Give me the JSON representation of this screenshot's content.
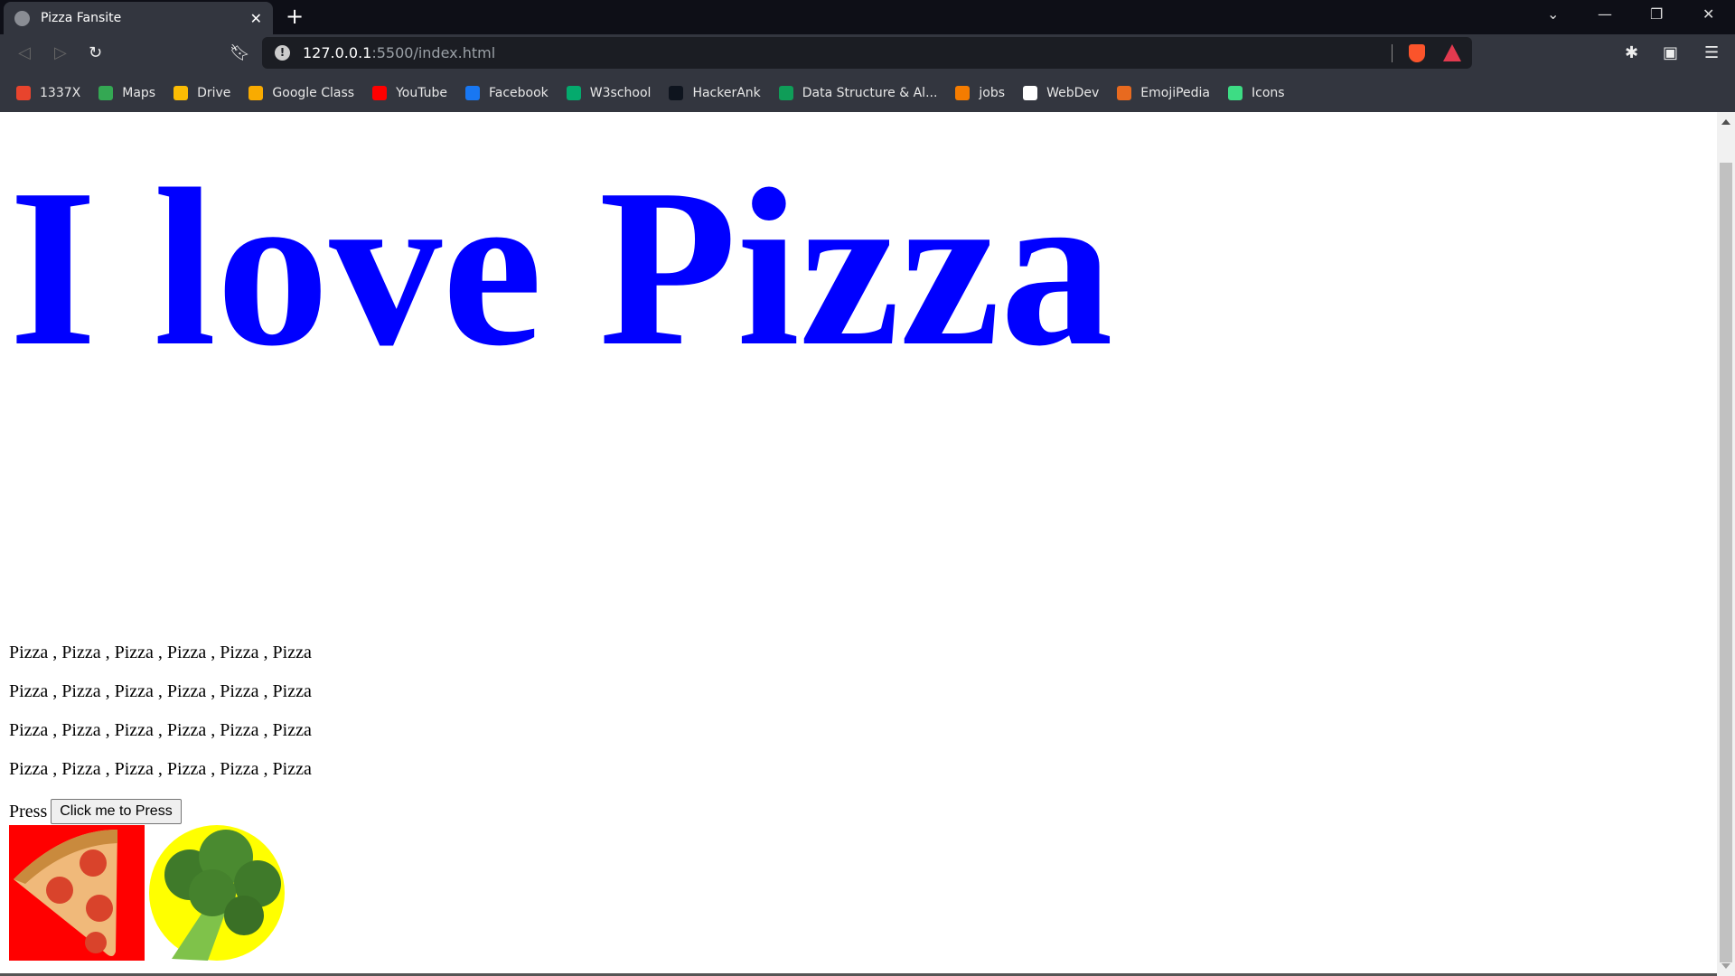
{
  "browser": {
    "tab_title": "Pizza Fansite",
    "url_host": "127.0.0.1",
    "url_rest": ":5500/index.html",
    "bookmarks": [
      {
        "label": "1337X",
        "color": "#e8442d"
      },
      {
        "label": "Maps",
        "color": "#34a853"
      },
      {
        "label": "Drive",
        "color": "#fbbc04"
      },
      {
        "label": "Google Class",
        "color": "#f9ab00"
      },
      {
        "label": "YouTube",
        "color": "#ff0000"
      },
      {
        "label": "Facebook",
        "color": "#1877f2"
      },
      {
        "label": "W3school",
        "color": "#04aa6d"
      },
      {
        "label": "HackerAnk",
        "color": "#0e141e"
      },
      {
        "label": "Data Structure & Al...",
        "color": "#0f9d58"
      },
      {
        "label": "jobs",
        "color": "#f57c00"
      },
      {
        "label": "WebDev",
        "color": "#ffffff"
      },
      {
        "label": "EmojiPedia",
        "color": "#e86a1f"
      },
      {
        "label": "Icons",
        "color": "#3ddc84"
      }
    ]
  },
  "page": {
    "heading": "I love Pizza",
    "heading_color": "#0000ff",
    "paragraphs": [
      "Pizza , Pizza , Pizza , Pizza , Pizza , Pizza",
      "Pizza , Pizza , Pizza , Pizza , Pizza , Pizza",
      "Pizza , Pizza , Pizza , Pizza , Pizza , Pizza",
      "Pizza , Pizza , Pizza , Pizza , Pizza , Pizza"
    ],
    "press_label": "Press",
    "button_label": "Click me to Press"
  }
}
